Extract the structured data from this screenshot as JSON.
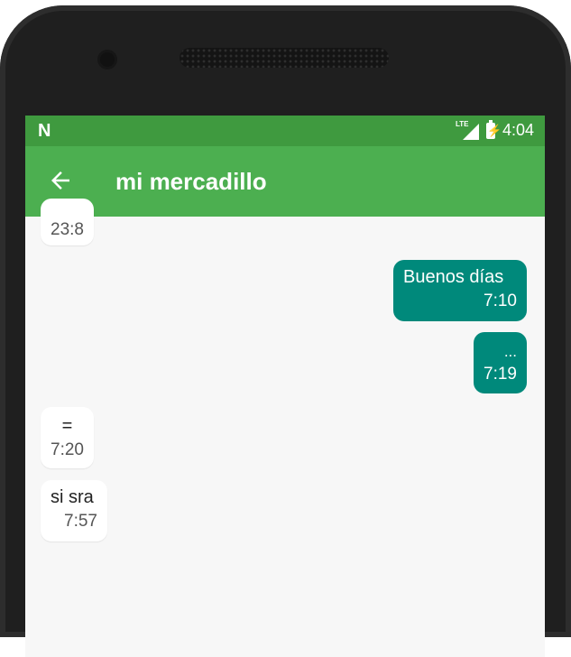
{
  "status_bar": {
    "notification_icon": "N",
    "network": "LTE",
    "time": "4:04"
  },
  "app_bar": {
    "back_icon": "arrow-left-icon",
    "title": "mi mercadillo"
  },
  "messages": [
    {
      "direction": "in",
      "text": "",
      "time": "23:8"
    },
    {
      "direction": "out",
      "text": "Buenos días",
      "time": "7:10"
    },
    {
      "direction": "out",
      "text": "...",
      "time": "7:19"
    },
    {
      "direction": "in",
      "text": "=",
      "time": "7:20"
    },
    {
      "direction": "in",
      "text": "si sra",
      "time": "7:57"
    }
  ],
  "colors": {
    "status_bar": "#3f9a3f",
    "app_bar": "#4caf50",
    "outgoing_bubble": "#00897b",
    "incoming_bubble": "#ffffff"
  }
}
